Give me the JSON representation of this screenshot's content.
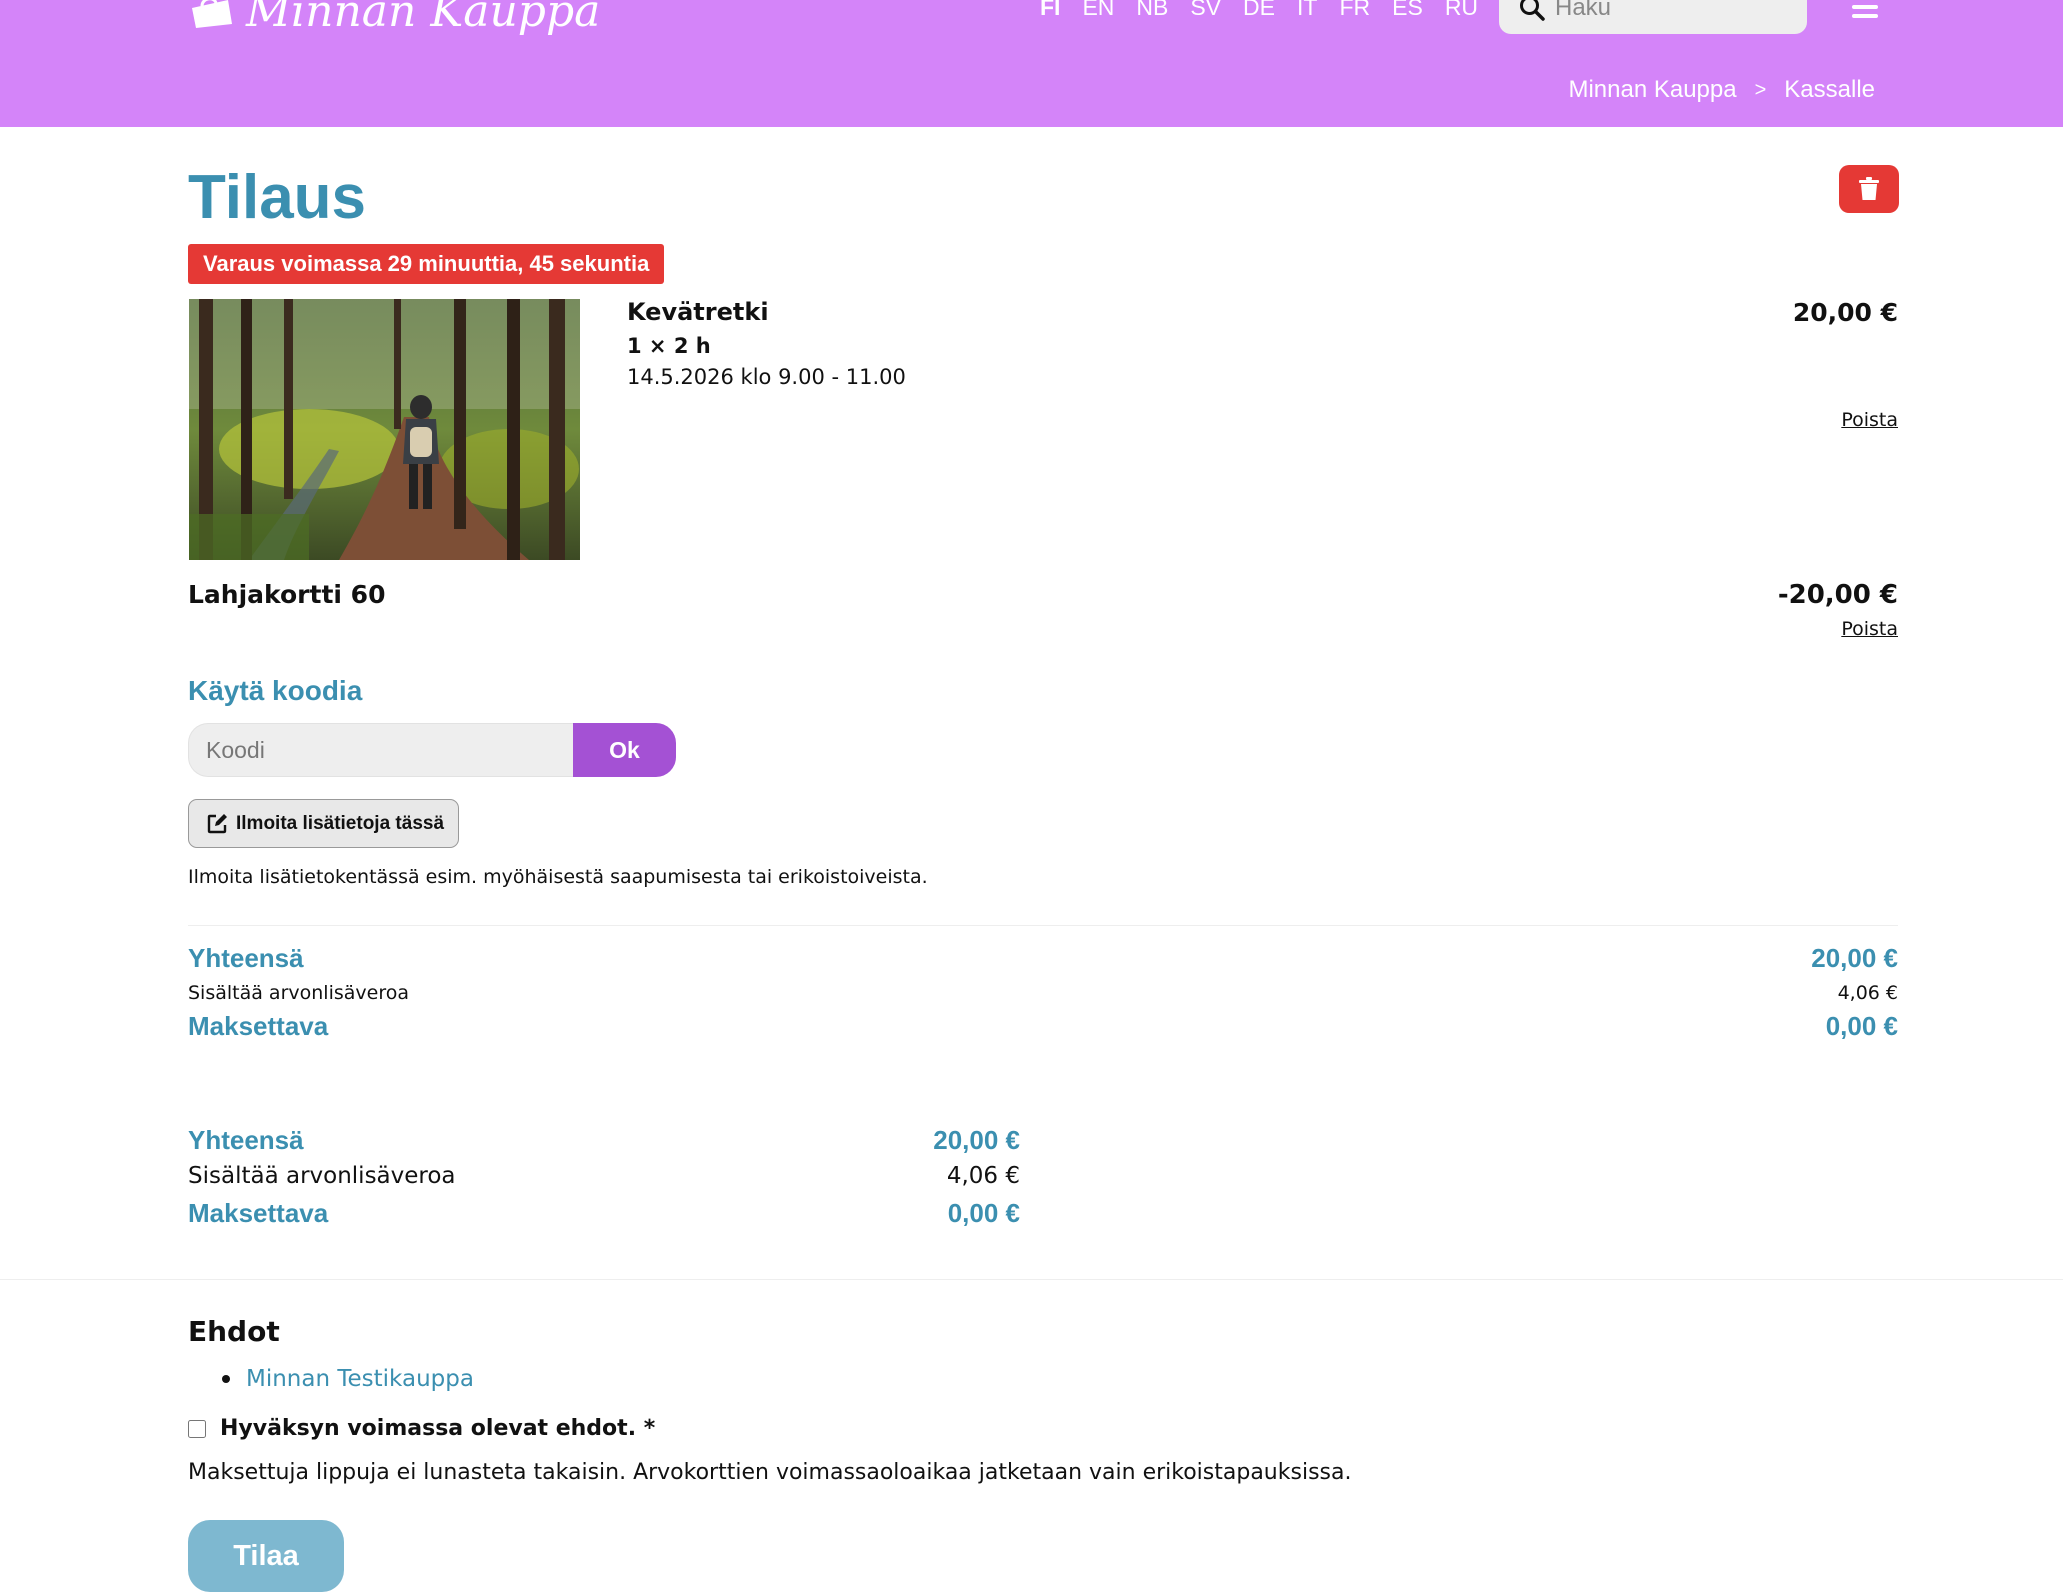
{
  "header": {
    "logo_text": "Minnan Kauppa",
    "languages": [
      "FI",
      "EN",
      "NB",
      "SV",
      "DE",
      "IT",
      "FR",
      "ES",
      "RU"
    ],
    "active_language": "FI",
    "search_placeholder": "Haku",
    "breadcrumb": [
      "Minnan Kauppa",
      "Kassalle"
    ],
    "breadcrumb_separator": ">"
  },
  "order": {
    "title": "Tilaus",
    "timer_text": "Varaus voimassa 29 minuuttia, 45 sekuntia",
    "product": {
      "name": "Kevätretki",
      "quantity": "1 × 2 h",
      "datetime": "14.5.2026 klo 9.00 - 11.00",
      "price": "20,00 €",
      "remove_label": "Poista"
    },
    "gift_card": {
      "name": "Lahjakortti 60",
      "amount": "-20,00 €",
      "remove_label": "Poista"
    }
  },
  "code": {
    "title": "Käytä koodia",
    "placeholder": "Koodi",
    "ok_label": "Ok"
  },
  "info": {
    "button_label": "Ilmoita lisätietoja tässä",
    "note": "Ilmoita lisätietokentässä esim. myöhäisestä saapumisesta tai erikoistoiveista."
  },
  "summary": {
    "total_label": "Yhteensä",
    "total_value": "20,00 €",
    "vat_label": "Sisältää arvonlisäveroa",
    "vat_value": "4,06 €",
    "payable_label": "Maksettava",
    "payable_value": "0,00 €"
  },
  "terms": {
    "title": "Ehdot",
    "links": [
      "Minnan Testikauppa"
    ],
    "accept_label": "Hyväksyn voimassa olevat ehdot. *",
    "refund_note": "Maksettuja lippuja ei lunasteta takaisin. Arvokorttien voimassaoloaikaa jatketaan vain erikoistapauksissa."
  },
  "submit_label": "Tilaa",
  "colors": {
    "header_bg": "#d484f9",
    "accent_blue": "#3b8fb0",
    "danger_red": "#e53935",
    "ok_purple": "#a451d4",
    "submit_disabled": "#7eb8d0"
  },
  "icons": {
    "logo": "shopping-bag-icon",
    "search": "search-icon",
    "menu": "hamburger-menu-icon",
    "empty_cart": "trash-icon",
    "info_button": "edit-note-icon"
  }
}
